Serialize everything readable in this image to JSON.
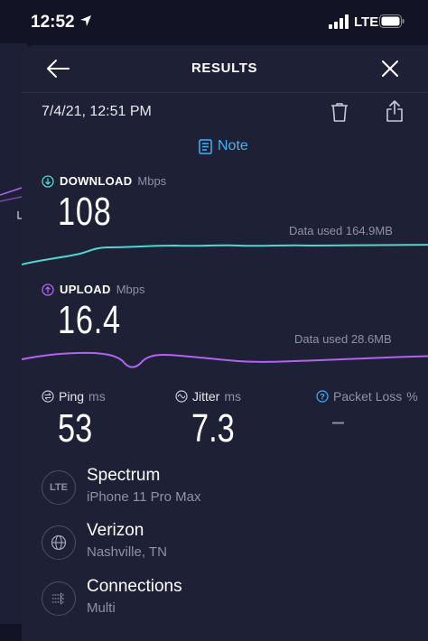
{
  "status_bar": {
    "time": "12:52",
    "network": "LTE"
  },
  "header": {
    "title": "RESULTS"
  },
  "result": {
    "datetime": "7/4/21, 12:51 PM",
    "note_label": "Note"
  },
  "download": {
    "label": "DOWNLOAD",
    "unit": "Mbps",
    "value": "108",
    "data_used": "Data used 164.9MB",
    "color": "#4fd6d0"
  },
  "upload": {
    "label": "UPLOAD",
    "unit": "Mbps",
    "value": "16.4",
    "data_used": "Data used 28.6MB",
    "color": "#b164f0"
  },
  "stats": {
    "ping": {
      "label": "Ping",
      "unit": "ms",
      "value": "53"
    },
    "jitter": {
      "label": "Jitter",
      "unit": "ms",
      "value": "7.3"
    },
    "packet_loss": {
      "label": "Packet Loss",
      "unit": "%",
      "value": "–"
    }
  },
  "details": [
    {
      "icon": "lte-icon",
      "icon_text": "LTE",
      "title": "Spectrum",
      "subtitle": "iPhone 11 Pro Max"
    },
    {
      "icon": "globe-icon",
      "title": "Verizon",
      "subtitle": "Nashville, TN"
    },
    {
      "icon": "connections-icon",
      "title": "Connections",
      "subtitle": "Multi"
    }
  ],
  "colors": {
    "accent": "#3eb3ff",
    "background": "#1e2135"
  }
}
